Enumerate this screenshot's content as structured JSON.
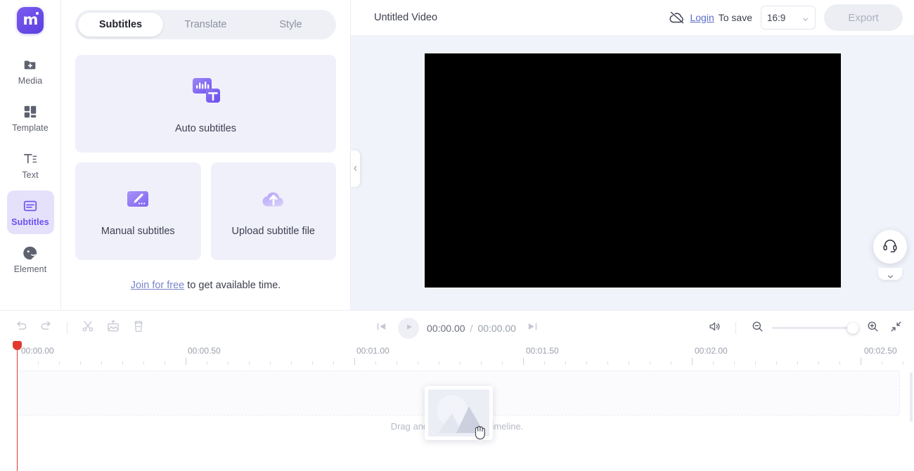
{
  "brand": {
    "logo_letter": "m",
    "accent": "#6c4ff0"
  },
  "sidebar": {
    "items": [
      {
        "label": "Media",
        "icon": "media-folder-plus-icon",
        "active": false
      },
      {
        "label": "Template",
        "icon": "template-grid-icon",
        "active": false
      },
      {
        "label": "Text",
        "icon": "text-t-icon",
        "active": false
      },
      {
        "label": "Subtitles",
        "icon": "subtitles-icon",
        "active": true
      },
      {
        "label": "Element",
        "icon": "element-sticker-icon",
        "active": false
      }
    ]
  },
  "panel": {
    "tabs": [
      {
        "label": "Subtitles",
        "active": true
      },
      {
        "label": "Translate",
        "active": false
      },
      {
        "label": "Style",
        "active": false
      }
    ],
    "cards": [
      {
        "label": "Auto subtitles",
        "icon": "auto-subtitles-icon"
      },
      {
        "label": "Manual subtitles",
        "icon": "manual-subtitles-icon"
      },
      {
        "label": "Upload subtitle file",
        "icon": "upload-cloud-icon"
      }
    ],
    "footer": {
      "link": "Join for free",
      "text": " to get available time."
    },
    "collapse_icon": "chevron-left-icon"
  },
  "header": {
    "title": "Untitled Video",
    "cloud_icon": "cloud-off-icon",
    "login_link": "Login",
    "save_text": "To save",
    "ratio": {
      "value": "16:9",
      "caret": "chevron-down-icon"
    },
    "export_label": "Export"
  },
  "preview": {
    "support_icon": "headset-support-icon",
    "collapse_icon": "chevron-down-icon"
  },
  "timeline": {
    "tools": [
      {
        "name": "undo-button",
        "icon": "undo-arrow-icon"
      },
      {
        "name": "redo-button",
        "icon": "redo-arrow-icon"
      },
      {
        "name": "split-button",
        "icon": "scissors-icon"
      },
      {
        "name": "add-frame-button",
        "icon": "image-plus-icon"
      },
      {
        "name": "delete-button",
        "icon": "trash-icon"
      }
    ],
    "playback": {
      "prev_frame_icon": "skip-previous-icon",
      "play_icon": "play-icon",
      "next_frame_icon": "skip-next-icon",
      "current_time": "00:00.00",
      "separator": "/",
      "total_time": "00:00.00"
    },
    "right_controls": {
      "volume_icon": "speaker-icon",
      "zoom_out_icon": "zoom-out-icon",
      "zoom_in_icon": "zoom-in-icon",
      "zoom_value": 100,
      "fit_icon": "collapse-arrows-icon"
    },
    "ruler": {
      "labels": [
        "00:00.00",
        "00:00.50",
        "00:01.00",
        "00:01.50",
        "00:02.00",
        "00:02.50"
      ],
      "label_x": [
        30,
        267,
        507,
        748,
        988,
        1229
      ],
      "major_x": [
        24,
        264,
        504,
        745,
        985,
        1226
      ],
      "minor_spacing": 30
    },
    "playhead_time": "00:00.00",
    "drop_hint": "Drag and drop media to timeline.",
    "drag_ghost": {
      "icon": "image-placeholder-icon",
      "cursor": "grabbing-hand-cursor"
    }
  }
}
